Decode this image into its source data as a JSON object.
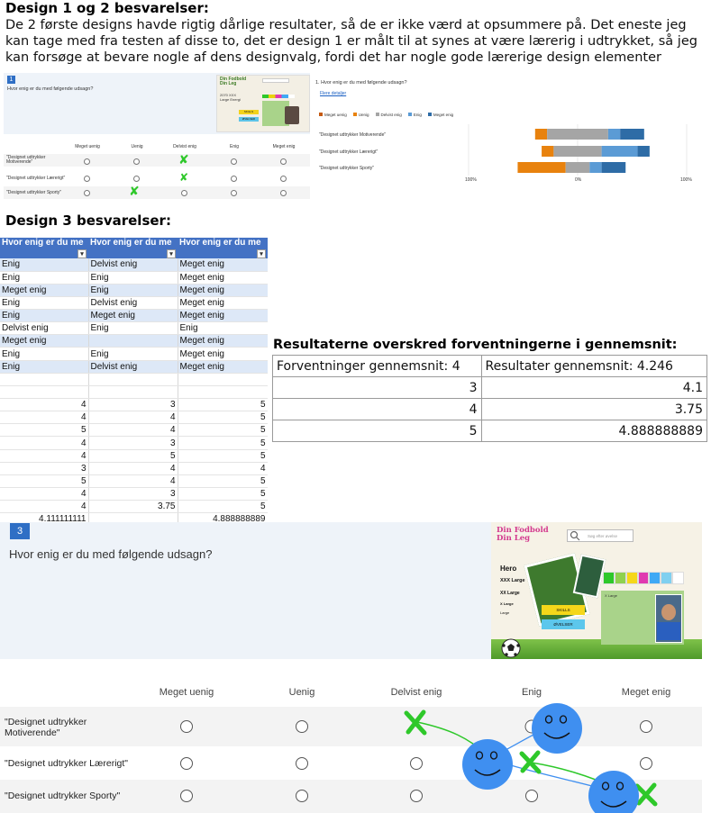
{
  "section1": {
    "heading": "Design 1 og 2 besvarelser:",
    "paragraph_lines": [
      "De 2 første designs havde rigtig dårlige resultater, så de er ikke værd at opsummere på. Det eneste jeg",
      "kan tage med fra testen af disse to, det er design 1 er målt til at synes at være lærerig i udtrykket, så jeg",
      "kan forsøge at bevare nogle af dens designvalg, fordi det har nogle gode lærerige design elementer"
    ]
  },
  "small_form": {
    "number": "1",
    "question": "Hvor enig er du med følgende udsagn?",
    "columns": [
      "Meget uenig",
      "Uenig",
      "Delvist enig",
      "Enig",
      "Meget enig"
    ],
    "rows": [
      "\"Designet udtrykker Motiverende\"",
      "\"Designet udtrykker Lærerigt\"",
      "\"Designet udtrykker Sporty\""
    ],
    "thumb_title": "Din Fodbold Din Leg",
    "thumb_text": "2070 XXX Large Energi",
    "thumb_btn1": "SKILLS",
    "thumb_btn2": "ØVELSER"
  },
  "small_chart": {
    "question": "1.  Hvor enig er du med følgende udsagn?",
    "link": "Flere detaljer",
    "legend": [
      "Meget uenig",
      "Uenig",
      "Delvist enig",
      "Enig",
      "Meget enig"
    ],
    "rows": [
      "\"Designet udtrykker Motiverende\"",
      "\"Designet udtrykker Lærerigt\"",
      "\"Designet udtrykker Sporty\""
    ],
    "axis": [
      "100%",
      "0%",
      "100%"
    ]
  },
  "colors": {
    "meget_uenig": "#c55a11",
    "uenig": "#e8820e",
    "delvist_enig": "#a5a5a5",
    "enig": "#5b9bd5",
    "meget_enig": "#2e6ca6",
    "excel_header": "#4472c4",
    "form_blue": "#2f6fc5",
    "smiley": "#3f8ff0",
    "x_green": "#2ec82a"
  },
  "chart_data": {
    "type": "bar",
    "stacked": "diverging",
    "categories": [
      "\"Designet udtrykker Motiverende\"",
      "\"Designet udtrykker Lærerigt\"",
      "\"Designet udtrykker Sporty\""
    ],
    "series": [
      {
        "name": "Meget uenig",
        "values": [
          0,
          0,
          0
        ]
      },
      {
        "name": "Uenig",
        "values": [
          11,
          11,
          44
        ]
      },
      {
        "name": "Delvist enig",
        "values": [
          56,
          44,
          22
        ]
      },
      {
        "name": "Enig",
        "values": [
          11,
          33,
          11
        ]
      },
      {
        "name": "Meget enig",
        "values": [
          22,
          11,
          22
        ]
      }
    ],
    "xlim": [
      -100,
      100
    ],
    "legend_position": "top"
  },
  "section2": {
    "heading": "Design 3 besvarelser:"
  },
  "excel": {
    "headers": [
      "Hvor enig er du me",
      "Hvor enig er du me",
      "Hvor enig er du me"
    ],
    "rows": [
      [
        "Enig",
        "Delvist enig",
        "Meget enig"
      ],
      [
        "Enig",
        "Enig",
        "Meget enig"
      ],
      [
        "Meget enig",
        "Enig",
        "Meget enig"
      ],
      [
        "Enig",
        "Delvist enig",
        "Meget enig"
      ],
      [
        "Enig",
        "Meget enig",
        "Meget enig"
      ],
      [
        "Delvist enig",
        "Enig",
        "Enig"
      ],
      [
        "Meget enig",
        "",
        "Meget enig"
      ],
      [
        "Enig",
        "Enig",
        "Meget enig"
      ],
      [
        "Enig",
        "Delvist enig",
        "Meget enig"
      ]
    ],
    "numeric_rows": [
      [
        "",
        "",
        ""
      ],
      [
        "",
        "",
        ""
      ],
      [
        "4",
        "3",
        "5"
      ],
      [
        "4",
        "4",
        "5"
      ],
      [
        "5",
        "4",
        "5"
      ],
      [
        "4",
        "3",
        "5"
      ],
      [
        "4",
        "5",
        "5"
      ],
      [
        "3",
        "4",
        "4"
      ],
      [
        "5",
        "4",
        "5"
      ],
      [
        "4",
        "3",
        "5"
      ],
      [
        "4",
        "3.75",
        "5"
      ],
      [
        "4.111111111",
        "",
        "4.888888889"
      ]
    ]
  },
  "summary": {
    "heading": "Resultaterne overskred forventningerne i gennemsnit:",
    "col1_header": "Forventninger gennemsnit: 4",
    "col2_header": "Resultater gennemsnit: 4.246",
    "rows": [
      [
        "3",
        "4.1"
      ],
      [
        "4",
        "3.75"
      ],
      [
        "5",
        "4.888888889"
      ]
    ]
  },
  "big_form": {
    "number": "3",
    "question": "Hvor enig er du med følgende udsagn?",
    "columns": [
      "Meget uenig",
      "Uenig",
      "Delvist enig",
      "Enig",
      "Meget enig"
    ],
    "rows": [
      "\"Designet udtrykker\nMotiverende\"",
      "\"Designet udtrykker Lærerigt\"",
      "\"Designet udtrykker Sporty\""
    ],
    "thumb_title": "Din Fodbold Din Leg",
    "thumb_search": "Søg efter øvelse",
    "thumb_hero": "Hero",
    "thumb_sub1": "XXX Large",
    "thumb_sub2": "XX Large",
    "thumb_sub3": "X Large",
    "thumb_sub4": "Large",
    "thumb_btn1": "SKILLS",
    "thumb_btn2": "ØVELSER",
    "thumb_card": "X Large"
  }
}
